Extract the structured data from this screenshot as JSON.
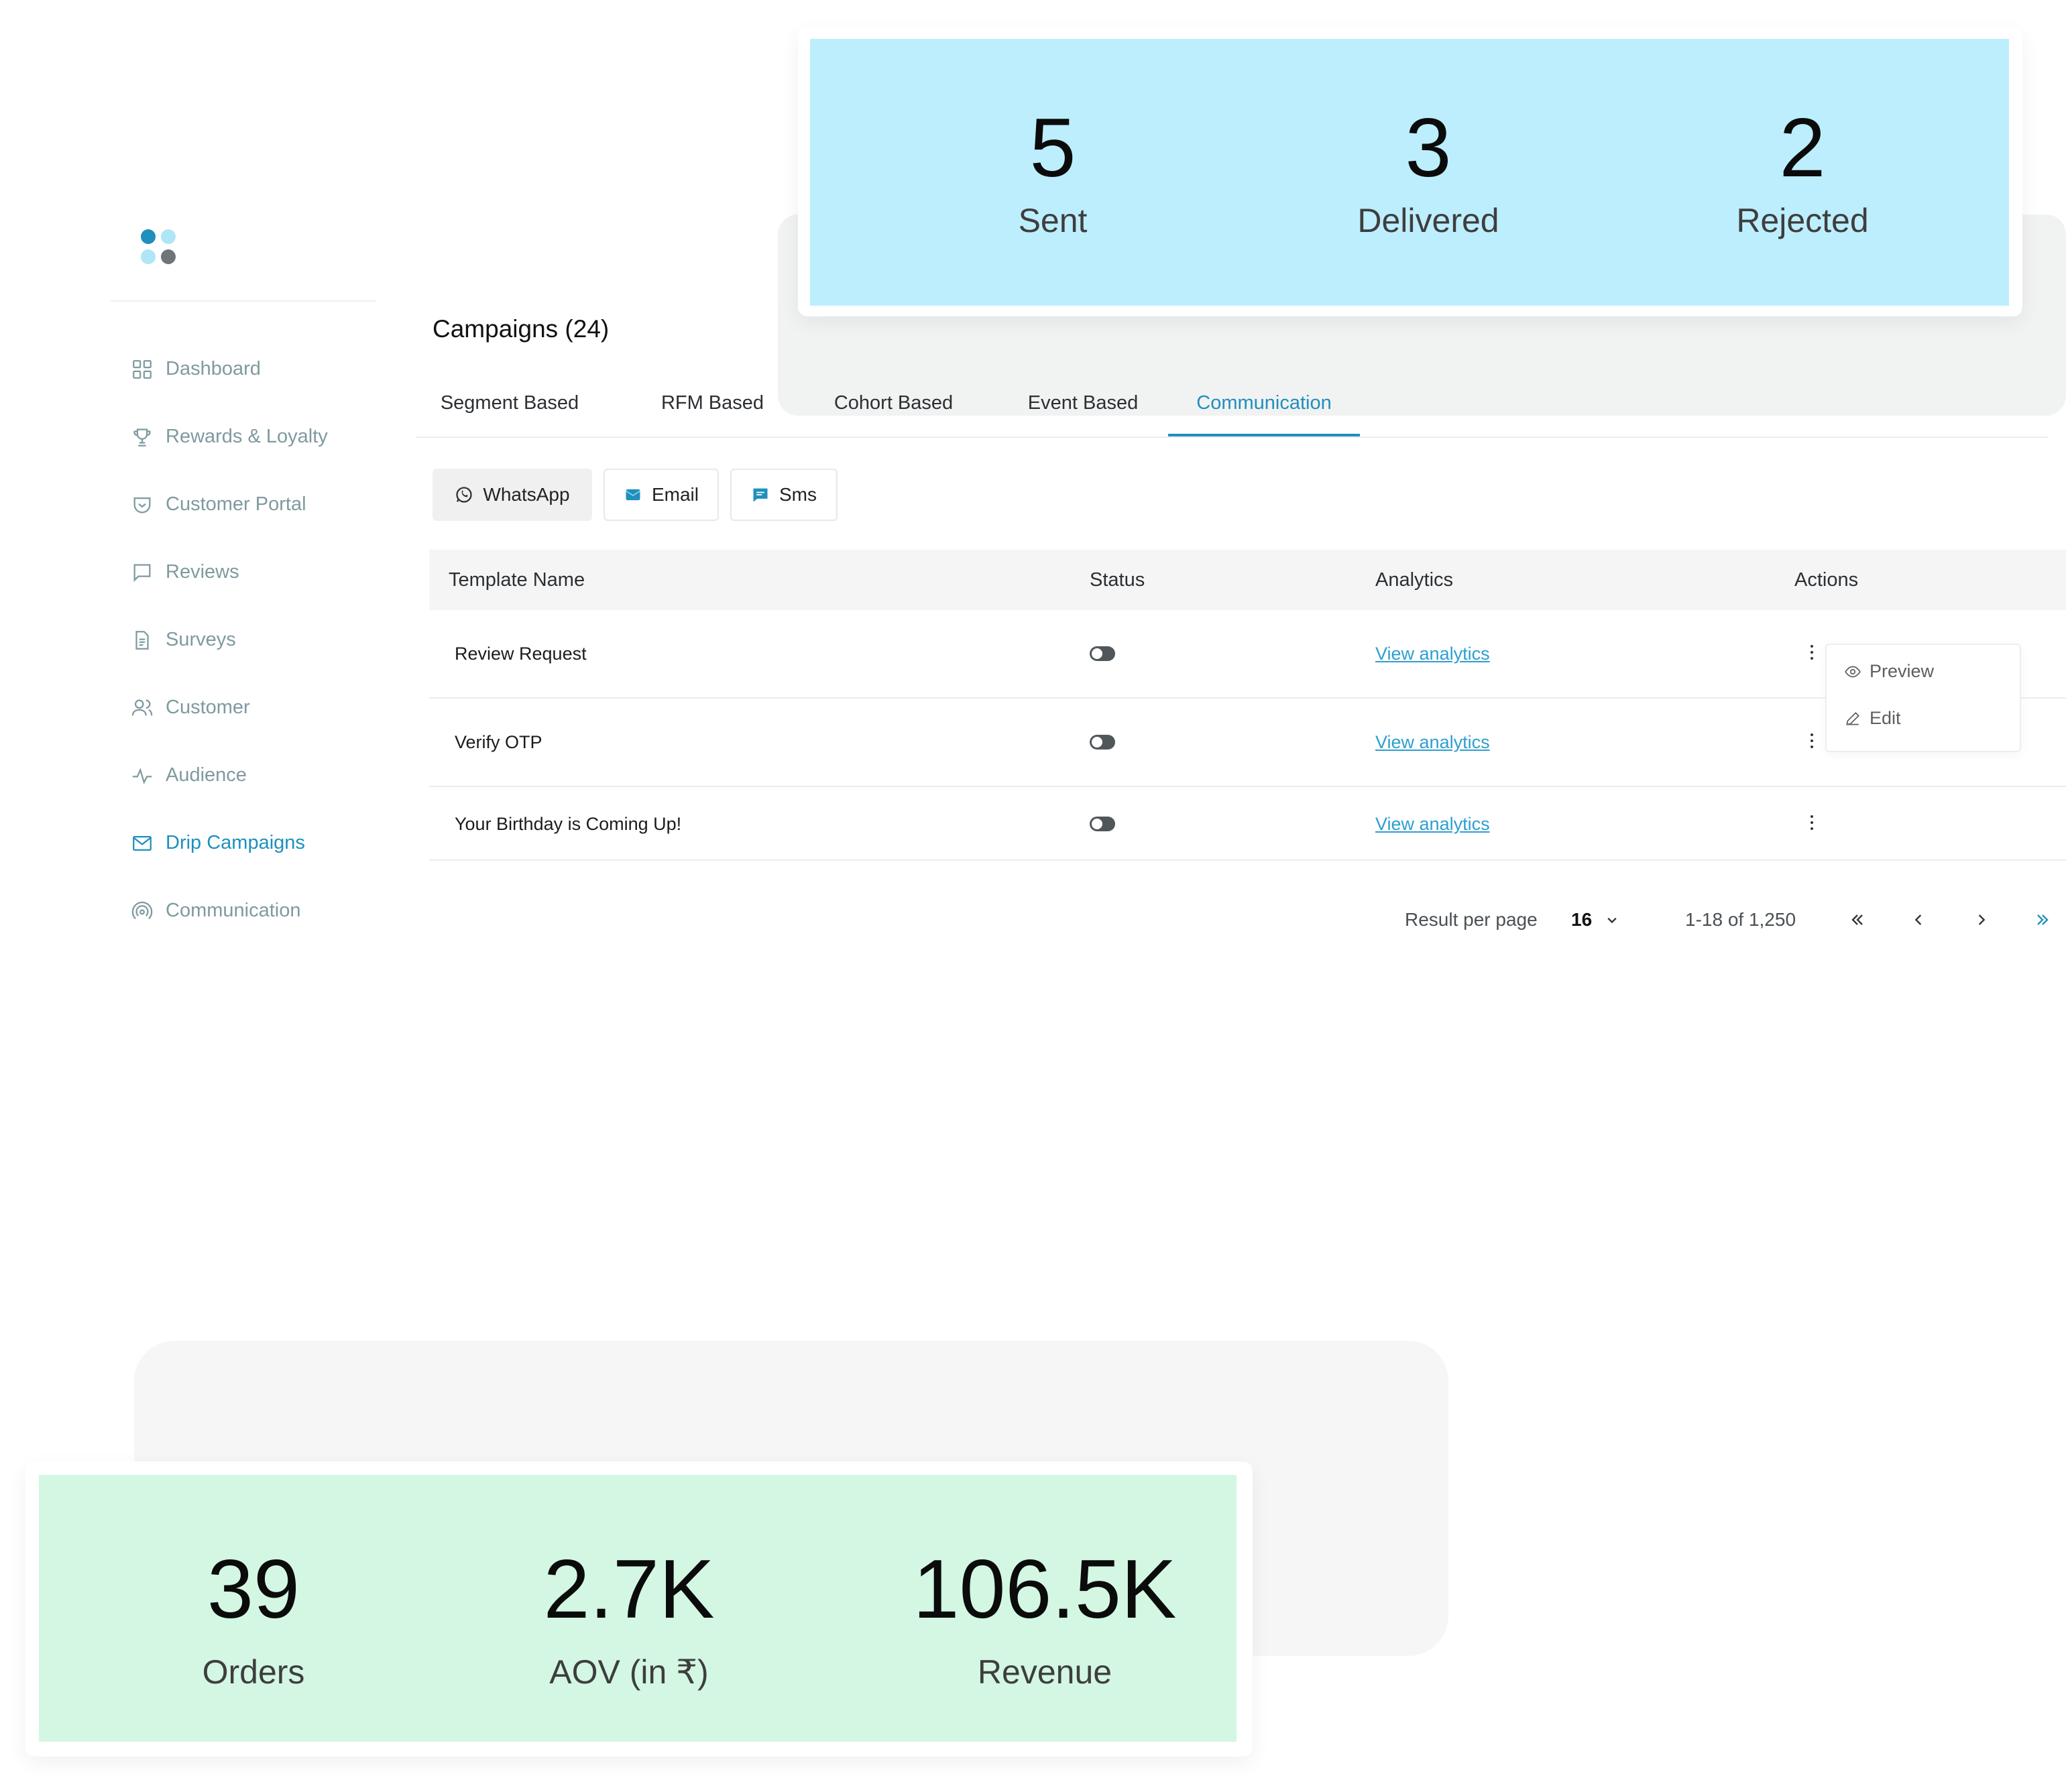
{
  "colors": {
    "accent": "#1f8fbd",
    "link": "#2d9fd0",
    "blue_card": "#bdeefd",
    "green_card": "#d3f7e2"
  },
  "sidebar": {
    "items": [
      {
        "label": "Dashboard",
        "icon": "grid-icon"
      },
      {
        "label": "Rewards & Loyalty",
        "icon": "trophy-icon"
      },
      {
        "label": "Customer Portal",
        "icon": "shield-icon"
      },
      {
        "label": "Reviews",
        "icon": "comment-icon"
      },
      {
        "label": "Surveys",
        "icon": "document-icon"
      },
      {
        "label": "Customer",
        "icon": "users-icon"
      },
      {
        "label": "Audience",
        "icon": "activity-icon"
      },
      {
        "label": "Drip Campaigns",
        "icon": "mail-icon",
        "active": true
      },
      {
        "label": "Communication",
        "icon": "broadcast-icon"
      }
    ]
  },
  "page": {
    "title": "Campaigns (24)"
  },
  "tabs": [
    {
      "label": "Segment Based"
    },
    {
      "label": "RFM Based"
    },
    {
      "label": "Cohort Based"
    },
    {
      "label": "Event Based"
    },
    {
      "label": "Communication",
      "active": true
    }
  ],
  "channels": [
    {
      "label": "WhatsApp",
      "icon": "whatsapp-icon",
      "active": true
    },
    {
      "label": "Email",
      "icon": "email-icon"
    },
    {
      "label": "Sms",
      "icon": "sms-icon"
    }
  ],
  "table": {
    "headers": [
      "Template Name",
      "Status",
      "Analytics",
      "Actions"
    ],
    "rows": [
      {
        "name": "Review Request",
        "analytics": "View analytics"
      },
      {
        "name": "Verify OTP",
        "analytics": "View analytics"
      },
      {
        "name": "Your Birthday is Coming Up!",
        "analytics": "View analytics"
      }
    ]
  },
  "actions_menu": {
    "preview": "Preview",
    "edit": "Edit"
  },
  "pagination": {
    "label": "Result per page",
    "per_page": "16",
    "range": "1-18 of 1,250"
  },
  "stats_top": [
    {
      "value": "5",
      "label": "Sent"
    },
    {
      "value": "3",
      "label": "Delivered"
    },
    {
      "value": "2",
      "label": "Rejected"
    }
  ],
  "stats_bottom": [
    {
      "value": "39",
      "label": "Orders"
    },
    {
      "value": "2.7K",
      "label": "AOV (in ₹)"
    },
    {
      "value": "106.5K",
      "label": "Revenue"
    }
  ]
}
